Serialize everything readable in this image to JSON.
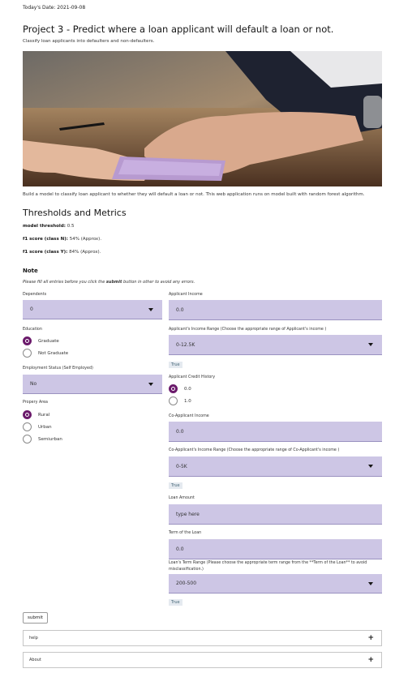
{
  "header": {
    "date": "Today's Date: 2021-09-08",
    "title": "Project 3 - Predict where a loan applicant will default a loan or not.",
    "subtitle": "Classify loan applicants into defaulters and non-defaulters.",
    "description": "Build a model to classify loan applicant to whether they will default a loan or not. This web application runs on model built with random forest algorithm."
  },
  "metrics": {
    "heading": "Thresholds and Metrics",
    "threshold_label": "model threshold:",
    "threshold_value": "0.5",
    "f1n_label": "f1 score (class N):",
    "f1n_value": "54% (Approx).",
    "f1y_label": "f1 score (class Y):",
    "f1y_value": "84% (Approx)."
  },
  "note": {
    "heading": "Note",
    "text_before": "Please fill all entries before you click the",
    "text_bold": "submit",
    "text_after": "button in other to avoid any errors."
  },
  "left": {
    "dependents_label": "Dependents",
    "dependents_value": "0",
    "education_label": "Education",
    "education_options": [
      "Graduate",
      "Not Graduate"
    ],
    "employment_label": "Employment Status (Self Employed)",
    "employment_value": "No",
    "property_label": "Propery Area",
    "property_options": [
      "Rural",
      "Urban",
      "Semiurban"
    ]
  },
  "right": {
    "applicant_income_label": "Applicant Income",
    "applicant_income_value": "0.0",
    "income_range_label": "Applicant's Income Range (Choose the appropriate range of Applicant's income )",
    "income_range_value": "0-12.5K",
    "income_range_tag": "True",
    "credit_history_label": "Applicant Credit History",
    "credit_history_options": [
      "0.0",
      "1.0"
    ],
    "coapp_income_label": "Co-Applicant Income",
    "coapp_income_value": "0.0",
    "coapp_range_label": "Co-Applicant's Income Range (Choose the appropriate range of Co-Applicant's income )",
    "coapp_range_value": "0-5K",
    "coapp_range_tag": "True",
    "loan_amount_label": "Loan Amount",
    "loan_amount_placeholder": "type here",
    "term_label": "Term of the Loan",
    "term_value": "0.0",
    "term_range_label_1": "Loan's Term Range (Please choose the appropriate term range from the **Term of the Loan** to avoid",
    "term_range_label_2": "misclassification.)",
    "term_range_value": "200-500",
    "term_range_tag": "True"
  },
  "actions": {
    "submit_label": "submit",
    "help_label": "help",
    "about_label": "About"
  },
  "colors": {
    "field_bg": "#cdc6e5",
    "radio_selected": "#6b1a6b"
  }
}
